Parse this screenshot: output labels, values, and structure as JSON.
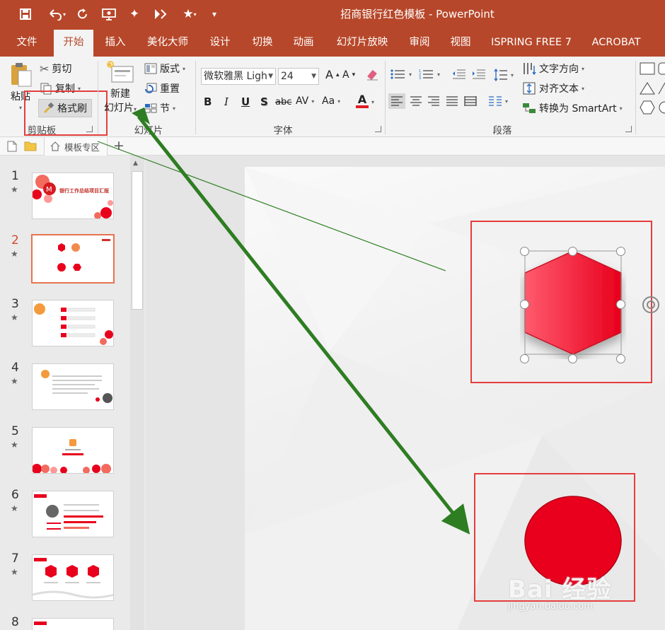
{
  "title_bar": {
    "document_title": "招商银行红色模板 - PowerPoint",
    "quick_access": [
      "save-icon",
      "undo-icon",
      "redo-icon",
      "present-icon",
      "star-icon",
      "animation-icon",
      "favorite-icon",
      "customize-icon"
    ]
  },
  "tabs": [
    "文件",
    "开始",
    "插入",
    "美化大师",
    "设计",
    "切换",
    "动画",
    "幻灯片放映",
    "审阅",
    "视图",
    "ISPRING FREE 7",
    "ACROBAT"
  ],
  "ribbon": {
    "clipboard": {
      "paste": "粘贴",
      "cut": "剪切",
      "copy": "复制",
      "format_painter": "格式刷",
      "group": "剪贴板"
    },
    "slides": {
      "new_slide_line1": "新建",
      "new_slide_line2": "幻灯片",
      "layout": "版式",
      "reset": "重置",
      "section": "节",
      "group": "幻灯片"
    },
    "font": {
      "font_name": "微软雅黑 Ligh",
      "font_size": "24",
      "bold": "B",
      "italic": "I",
      "underline": "U",
      "shadow": "S",
      "strike": "abc",
      "spacing": "AV",
      "case": "Aa",
      "color": "A",
      "group": "字体"
    },
    "paragraph": {
      "text_direction": "文字方向",
      "align_text": "对齐文本",
      "smartart": "转换为 SmartArt",
      "group": "段落"
    }
  },
  "doc_tabs": {
    "template_tab": "模板专区",
    "add": "+"
  },
  "slides": [
    {
      "num": "1",
      "title": "银行工作总结项目汇报"
    },
    {
      "num": "2"
    },
    {
      "num": "3"
    },
    {
      "num": "4"
    },
    {
      "num": "5"
    },
    {
      "num": "6"
    },
    {
      "num": "7"
    },
    {
      "num": "8"
    }
  ],
  "selected_slide": 2,
  "colors": {
    "accent": "#b7472a",
    "shape_red": "#e8001c",
    "highlight": "#e53d3d",
    "arrow": "#2e7d22"
  },
  "watermark": {
    "brand": "Bai 经验",
    "url": "jingyan.baidu.com"
  }
}
